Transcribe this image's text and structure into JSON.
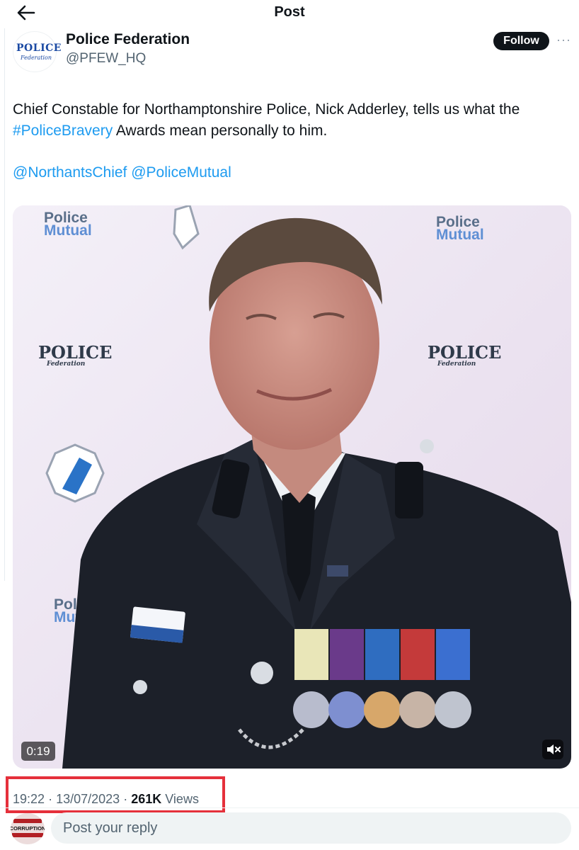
{
  "header": {
    "title": "Post",
    "back_icon": "arrow-left-icon"
  },
  "author": {
    "display_name": "Police Federation",
    "handle": "@PFEW_HQ",
    "logo_text_top": "POLICE",
    "logo_text_bottom": "Federation"
  },
  "actions": {
    "follow_label": "Follow",
    "more_label": "···"
  },
  "tweet": {
    "text_part1": "Chief Constable for Northamptonshire Police, Nick Adderley, tells us what the ",
    "hashtag": "#PoliceBravery",
    "text_part2": " Awards mean personally to him.",
    "mention1": "@NorthantsChief",
    "mention2": "@PoliceMutual"
  },
  "video": {
    "duration": "0:19",
    "mute_icon": "speaker-muted-icon",
    "backdrop_logos": {
      "mutual_top": "Police",
      "mutual_bottom": "Mutual",
      "federation_top": "POLICE",
      "federation_bottom": "Federation"
    }
  },
  "meta": {
    "time": "19:22",
    "date": "13/07/2023",
    "views_count": "261K",
    "views_label": "Views",
    "separator": "·"
  },
  "reply": {
    "placeholder": "Post your reply",
    "avatar_text": "CORRUPTION"
  },
  "colors": {
    "accent": "#1d9bf0",
    "text_primary": "#0f1419",
    "text_secondary": "#536471",
    "highlight": "#e5303b"
  }
}
